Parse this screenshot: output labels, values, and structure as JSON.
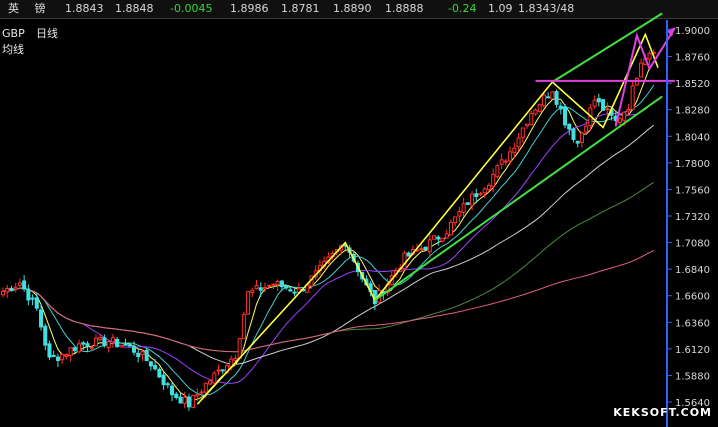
{
  "quote_bar": {
    "name": "英 镑",
    "values": [
      {
        "text": "1.8843",
        "color": "#d8d8d8"
      },
      {
        "text": "1.8848",
        "color": "#d8d8d8"
      },
      {
        "text": "-0.0045",
        "color": "#35d835"
      },
      {
        "text": "1.8986",
        "color": "#d8d8d8"
      },
      {
        "text": "1.8781",
        "color": "#d8d8d8"
      },
      {
        "text": "1.8890",
        "color": "#d8d8d8"
      },
      {
        "text": "1.8888",
        "color": "#d8d8d8"
      },
      {
        "text": "-0.24",
        "color": "#35d835"
      },
      {
        "text": "1.09",
        "color": "#d8d8d8"
      },
      {
        "text": "1.8343/48",
        "color": "#d8d8d8"
      }
    ]
  },
  "watermark": "KEKSOFT.COM",
  "colors": {
    "up_candle": "#ff3030",
    "down_candle": "#40e0e0",
    "ma_short": "#ffff60",
    "ma_mid": "#40d0d0",
    "ma_long": "#a040ff",
    "ma_slow": "#d0d0d0",
    "ma_slower": "#4a8a3a",
    "ma_slowest": "#e06080",
    "trend_yellow": "#ffff40",
    "trend_green": "#40e040",
    "trend_magenta": "#e040e0",
    "axis": "#3060ff"
  },
  "chart_data": {
    "type": "candlestick",
    "title": "GBP",
    "subtitle": "日线",
    "indicator_label": "均线",
    "y_ticks": [
      "1.9000",
      "1.8760",
      "1.8520",
      "1.8280",
      "1.8040",
      "1.7800",
      "1.7560",
      "1.7320",
      "1.7080",
      "1.6840",
      "1.6600",
      "1.6360",
      "1.6120",
      "1.5880",
      "1.5640"
    ],
    "ylim": [
      1.555,
      1.909
    ],
    "bars": 155,
    "anchors": [
      [
        0,
        1.664
      ],
      [
        4,
        1.672
      ],
      [
        8,
        1.648
      ],
      [
        11,
        1.602
      ],
      [
        14,
        1.607
      ],
      [
        18,
        1.616
      ],
      [
        25,
        1.619
      ],
      [
        30,
        1.614
      ],
      [
        35,
        1.599
      ],
      [
        40,
        1.572
      ],
      [
        44,
        1.562
      ],
      [
        48,
        1.58
      ],
      [
        55,
        1.607
      ],
      [
        58,
        1.662
      ],
      [
        64,
        1.671
      ],
      [
        70,
        1.664
      ],
      [
        75,
        1.683
      ],
      [
        81,
        1.709
      ],
      [
        86,
        1.668
      ],
      [
        88,
        1.655
      ],
      [
        95,
        1.694
      ],
      [
        100,
        1.705
      ],
      [
        105,
        1.719
      ],
      [
        110,
        1.745
      ],
      [
        115,
        1.764
      ],
      [
        120,
        1.79
      ],
      [
        125,
        1.826
      ],
      [
        130,
        1.847
      ],
      [
        133,
        1.818
      ],
      [
        136,
        1.798
      ],
      [
        140,
        1.837
      ],
      [
        145,
        1.817
      ],
      [
        148,
        1.832
      ],
      [
        151,
        1.874
      ],
      [
        154,
        1.884
      ]
    ]
  },
  "trendlines": {
    "yellow": [
      [
        46,
        1.562
      ],
      [
        81,
        1.708
      ],
      [
        88,
        1.656
      ],
      [
        130,
        1.853
      ],
      [
        142,
        1.812
      ],
      [
        152,
        1.896
      ],
      [
        155,
        1.866
      ]
    ],
    "green_lower": [
      [
        88,
        1.656
      ],
      [
        156,
        1.84
      ]
    ],
    "green_upper": [
      [
        130,
        1.853
      ],
      [
        156,
        1.915
      ]
    ],
    "green_upper_left": [
      [
        81,
        1.706
      ],
      [
        88,
        1.656
      ]
    ],
    "magenta_level": [
      [
        126,
        1.854
      ],
      [
        159,
        1.854
      ]
    ],
    "magenta_arrow": [
      [
        145,
        1.813
      ],
      [
        150,
        1.895
      ],
      [
        153,
        1.865
      ],
      [
        159,
        1.902
      ]
    ]
  }
}
